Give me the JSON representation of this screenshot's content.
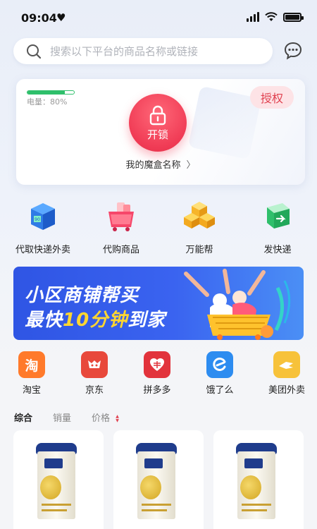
{
  "status_bar": {
    "time": "09:04",
    "heart": "♥"
  },
  "search": {
    "placeholder": "搜索以下平台的商品名称或链接"
  },
  "device": {
    "battery_label": "电量：80%",
    "battery_level": 0.8,
    "auth_label": "授权",
    "unlock_label": "开锁",
    "name": "我的魔盒名称",
    "chevron": "〉"
  },
  "services": [
    {
      "label": "代取快递外卖",
      "icon": "express-box-icon"
    },
    {
      "label": "代购商品",
      "icon": "shopping-cart-icon"
    },
    {
      "label": "万能帮",
      "icon": "cube-stack-icon"
    },
    {
      "label": "发快递",
      "icon": "parcel-send-icon"
    }
  ],
  "banner": {
    "line1": "小区商铺帮买",
    "line2_prefix": "最快",
    "line2_highlight": "10分钟",
    "line2_suffix": "到家"
  },
  "platforms": [
    {
      "label": "淘宝",
      "glyph": "淘",
      "color": "#ff7a2b"
    },
    {
      "label": "京东",
      "glyph": "🐕",
      "color": "#e8483b"
    },
    {
      "label": "拼多多",
      "glyph": "❤",
      "color": "#e2333c"
    },
    {
      "label": "饿了么",
      "glyph": "e",
      "color": "#2d8cf0"
    },
    {
      "label": "美团外卖",
      "glyph": "➜",
      "color": "#f7c23a"
    }
  ],
  "sort": {
    "comprehensive": "综合",
    "sales": "销量",
    "price": "价格"
  }
}
